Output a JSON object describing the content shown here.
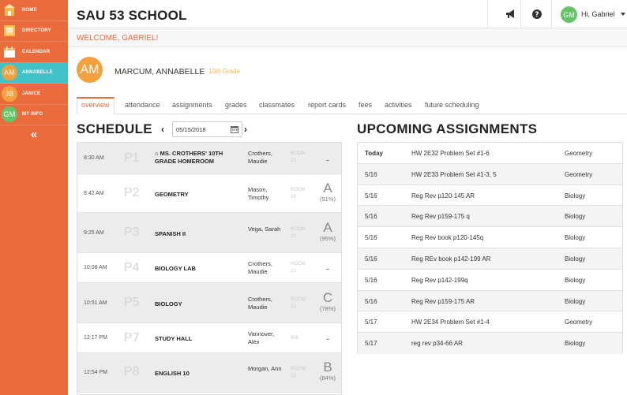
{
  "sidebar": {
    "items": [
      {
        "label": "HOME",
        "icon": "home-icon"
      },
      {
        "label": "DIRECTORY",
        "icon": "directory-icon"
      },
      {
        "label": "CALENDAR",
        "icon": "calendar-icon"
      },
      {
        "label": "ANNABELLE",
        "initials": "AM",
        "avatar_color": "#f4a13d",
        "active": true
      },
      {
        "label": "JANICE",
        "initials": "JB",
        "avatar_color": "#f4a13d"
      },
      {
        "label": "MY INFO",
        "initials": "GM",
        "avatar_color": "#65c467"
      }
    ],
    "collapse_glyph": "«"
  },
  "header": {
    "school": "SAU 53 SCHOOL",
    "user_initials": "GM",
    "greeting": "Hi, Gabriel",
    "welcome": "WELCOME, GABRIEL!"
  },
  "student": {
    "initials": "AM",
    "name": "MARCUM, ANNABELLE",
    "grade": "10th Grade"
  },
  "tabs": [
    "overview",
    "attendance",
    "assignments",
    "grades",
    "classmates",
    "report cards",
    "fees",
    "activities",
    "future scheduling"
  ],
  "schedule": {
    "title": "SCHEDULE",
    "date": "05/15/2018",
    "rows": [
      {
        "time": "8:30 AM",
        "period": "P1",
        "course": "MS. CROTHERS' 10TH GRADE HOMEROOM",
        "teacher": "Crothers, Maudie",
        "room": "ROOM 21",
        "letter": "-",
        "pct": ""
      },
      {
        "time": "8:42 AM",
        "period": "P2",
        "course": "GEOMETRY",
        "teacher": "Mason, Timothy",
        "room": "ROOM 18",
        "letter": "A",
        "pct": "(91%)"
      },
      {
        "time": "9:25 AM",
        "period": "P3",
        "course": "SPANISH II",
        "teacher": "Vega, Sarah",
        "room": "ROOM 20",
        "letter": "A",
        "pct": "(95%)"
      },
      {
        "time": "10:08 AM",
        "period": "P4",
        "course": "BIOLOGY LAB",
        "teacher": "Crothers, Maudie",
        "room": "ROOM 21",
        "letter": "-",
        "pct": ""
      },
      {
        "time": "10:51 AM",
        "period": "P5",
        "course": "BIOLOGY",
        "teacher": "Crothers, Maudie",
        "room": "ROOM 21",
        "letter": "C",
        "pct": "(78%)"
      },
      {
        "time": "12:17 PM",
        "period": "P7",
        "course": "STUDY HALL",
        "teacher": "Vannover, Alex",
        "room": "908",
        "letter": "-",
        "pct": ""
      },
      {
        "time": "12:54 PM",
        "period": "P8",
        "course": "ENGLISH 10",
        "teacher": "Morgan, Ann",
        "room": "ROOM 22",
        "letter": "B",
        "pct": "(84%)"
      }
    ]
  },
  "assignments": {
    "title": "UPCOMING ASSIGNMENTS",
    "rows": [
      {
        "date": "Today",
        "title": "HW 2E32 Problem Set #1-6",
        "subject": "Geometry"
      },
      {
        "date": "5/16",
        "title": "HW 2E33 Problem Set #1-3, 5",
        "subject": "Geometry"
      },
      {
        "date": "5/16",
        "title": "Reg Rev p120-145 AR",
        "subject": "Biology"
      },
      {
        "date": "5/16",
        "title": "Reg Rev p159-175 q",
        "subject": "Biology"
      },
      {
        "date": "5/16",
        "title": "Reg Rev book p120-145q",
        "subject": "Biology"
      },
      {
        "date": "5/16",
        "title": "Reg REv book p142-199 AR",
        "subject": "Biology"
      },
      {
        "date": "5/16",
        "title": "Reg Rev p142-199q",
        "subject": "Biology"
      },
      {
        "date": "5/16",
        "title": "Reg Rev p159-175 AR",
        "subject": "Biology"
      },
      {
        "date": "5/17",
        "title": "HW 2E34 Problem Set #1-4",
        "subject": "Geometry"
      },
      {
        "date": "5/17",
        "title": "reg rev p34-66 AR",
        "subject": "Biology"
      }
    ]
  },
  "colors": {
    "accent": "#ea6b3c",
    "active_teal": "#3fc3c9",
    "grade_yellow": "#f5b84a"
  }
}
